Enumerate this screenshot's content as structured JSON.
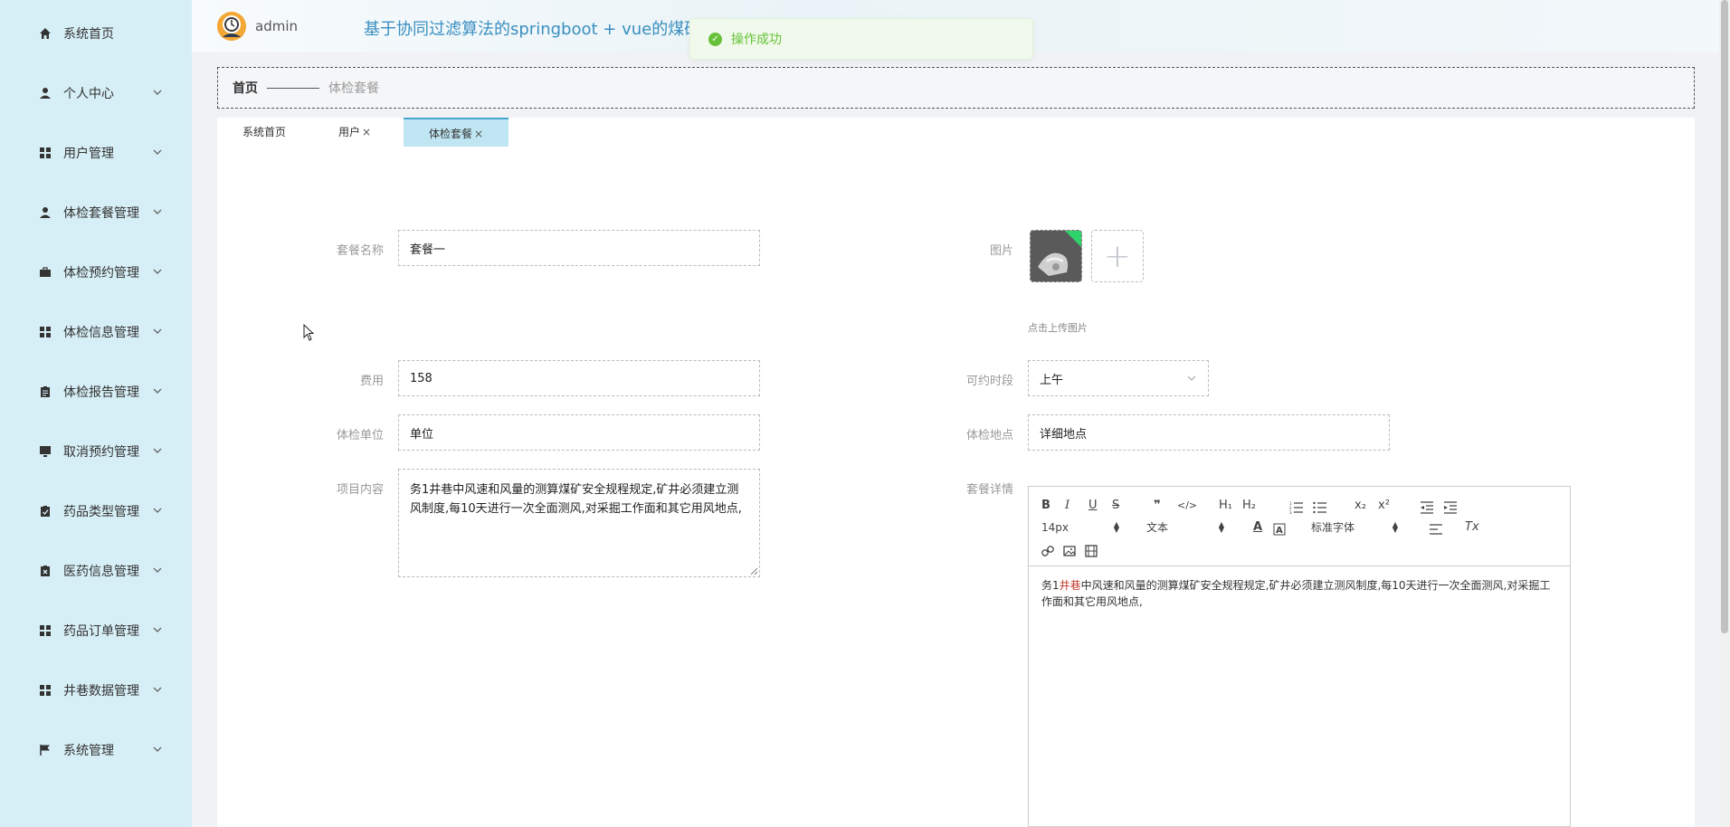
{
  "sidebar": {
    "items": [
      {
        "label": "系统首页",
        "icon": "home-icon",
        "has_chevron": false
      },
      {
        "label": "个人中心",
        "icon": "user-icon",
        "has_chevron": true
      },
      {
        "label": "用户管理",
        "icon": "grid-icon",
        "has_chevron": true
      },
      {
        "label": "体检套餐管理",
        "icon": "user-icon",
        "has_chevron": true
      },
      {
        "label": "体检预约管理",
        "icon": "briefcase-icon",
        "has_chevron": true
      },
      {
        "label": "体检信息管理",
        "icon": "grid-icon",
        "has_chevron": true
      },
      {
        "label": "体检报告管理",
        "icon": "clipboard-icon",
        "has_chevron": true
      },
      {
        "label": "取消预约管理",
        "icon": "monitor-icon",
        "has_chevron": true
      },
      {
        "label": "药品类型管理",
        "icon": "clipboard-check-icon",
        "has_chevron": true
      },
      {
        "label": "医药信息管理",
        "icon": "clipboard-x-icon",
        "has_chevron": true
      },
      {
        "label": "药品订单管理",
        "icon": "grid-icon",
        "has_chevron": true
      },
      {
        "label": "井巷数据管理",
        "icon": "grid-icon",
        "has_chevron": true
      },
      {
        "label": "系统管理",
        "icon": "flag-icon",
        "has_chevron": true
      }
    ]
  },
  "header": {
    "username": "admin",
    "system_title": "基于协同过滤算法的springboot + vue的煤矿"
  },
  "toast": {
    "message": "操作成功",
    "color": "#67c23a"
  },
  "breadcrumb": {
    "home": "首页",
    "current": "体检套餐"
  },
  "tabs": [
    {
      "label": "系统首页",
      "closable": false,
      "active": false
    },
    {
      "label": "用户",
      "closable": true,
      "active": false
    },
    {
      "label": "体检套餐",
      "closable": true,
      "active": true
    }
  ],
  "tab_close_glyph": "×",
  "form": {
    "package_name": {
      "label": "套餐名称",
      "value": "套餐一"
    },
    "image": {
      "label": "图片",
      "hint": "点击上传图片",
      "add_glyph": "+"
    },
    "fee": {
      "label": "费用",
      "value": "158"
    },
    "time_slot": {
      "label": "可约时段",
      "value": "上午"
    },
    "unit": {
      "label": "体检单位",
      "value": "单位"
    },
    "location": {
      "label": "体检地点",
      "value": "详细地点"
    },
    "content": {
      "label": "项目内容",
      "value": "务1井巷中风速和风量的测算煤矿安全规程规定,矿井必须建立测风制度,每10天进行一次全面测风,对采掘工作面和其它用风地点,"
    },
    "details": {
      "label": "套餐详情",
      "text_before": "务1",
      "text_highlight": "井巷",
      "text_after": "中风速和风量的测算煤矿安全规程规定,矿井必须建立测风制度,每10天进行一次全面测风,对采掘工作面和其它用风地点,"
    }
  },
  "editor_toolbar": {
    "bold": "B",
    "italic": "I",
    "underline": "U",
    "strike": "S",
    "quote": "❞",
    "code": "</>",
    "h1": "H₁",
    "h2": "H₂",
    "subscript": "x₂",
    "superscript": "x²",
    "size": "14px",
    "header": "文本",
    "font": "标准字体",
    "color_a": "A",
    "clean": "Tx"
  }
}
